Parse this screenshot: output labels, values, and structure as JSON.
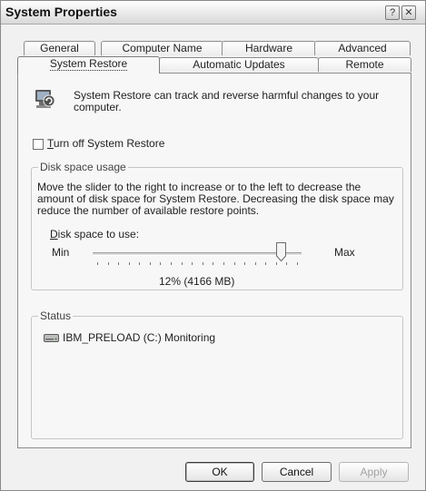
{
  "window": {
    "title": "System Properties",
    "help_label": "?",
    "close_label": "✕"
  },
  "tabs": {
    "row_back": [
      {
        "label": "General"
      },
      {
        "label": "Computer Name"
      },
      {
        "label": "Hardware"
      },
      {
        "label": "Advanced"
      }
    ],
    "row_front": [
      {
        "label": "System Restore",
        "active": true
      },
      {
        "label": "Automatic Updates"
      },
      {
        "label": "Remote"
      }
    ]
  },
  "system_restore": {
    "description": "System Restore can track and reverse harmful changes to your computer.",
    "icon": "system-restore-icon",
    "turn_off_checkbox": {
      "label_mnemonic": "T",
      "label_rest": "urn off System Restore",
      "checked": false
    }
  },
  "disk_space": {
    "group_label": "Disk space usage",
    "instructions": "Move the slider to the right to increase or to the left to decrease the amount of disk space for System Restore. Decreasing the disk space may reduce the number of available restore points.",
    "slider_label_mnemonic": "D",
    "slider_label_rest": "isk space to use:",
    "min_label": "Min",
    "max_label": "Max",
    "slider_value_percent": 12,
    "value_text": "12% (4166 MB)"
  },
  "status": {
    "group_label": "Status",
    "drives": [
      {
        "icon": "hard-drive-icon",
        "text": "IBM_PRELOAD (C:) Monitoring"
      }
    ]
  },
  "buttons": {
    "ok": "OK",
    "cancel": "Cancel",
    "apply": "Apply"
  }
}
